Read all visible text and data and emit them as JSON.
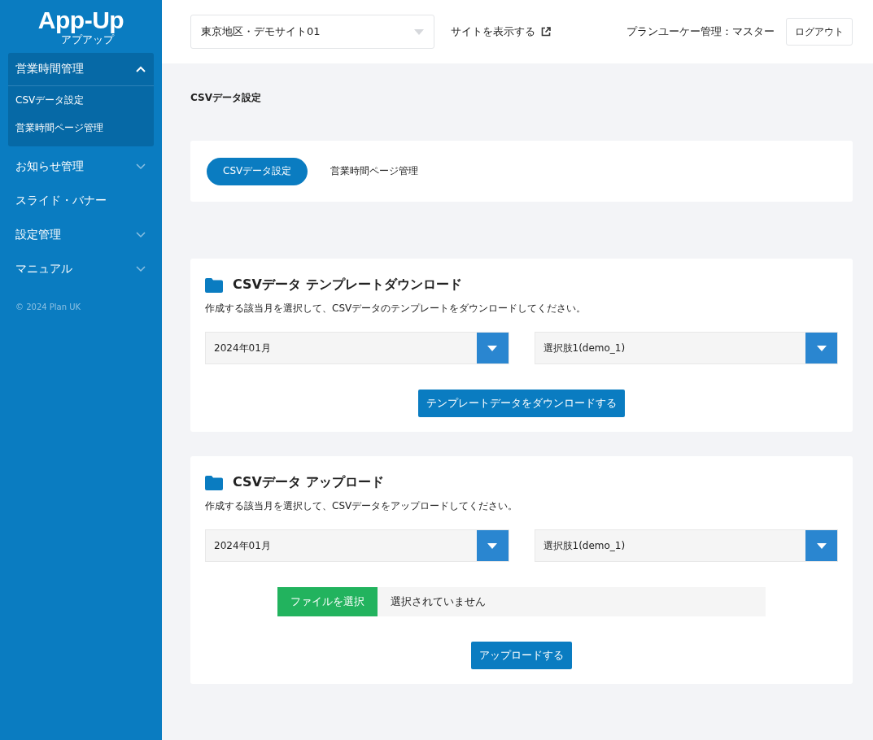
{
  "sidebar": {
    "logo": "App-Up",
    "logo_sub": "アプアップ",
    "items": [
      {
        "label": "営業時間管理",
        "kind": "group",
        "expanded": true,
        "children": [
          {
            "label": "CSVデータ設定"
          },
          {
            "label": "営業時間ページ管理"
          }
        ]
      },
      {
        "label": "お知らせ管理",
        "kind": "group",
        "expanded": false
      },
      {
        "label": "スライド・バナー",
        "kind": "link"
      },
      {
        "label": "設定管理",
        "kind": "group",
        "expanded": false
      },
      {
        "label": "マニュアル",
        "kind": "group",
        "expanded": false
      }
    ],
    "copyright": "© 2024 Plan UK"
  },
  "header": {
    "site_select": "東京地区・デモサイト01",
    "view_site_link": "サイトを表示する",
    "user": "プランユーケー管理：マスター",
    "logout": "ログアウト"
  },
  "page_title": "CSVデータ設定",
  "tabs": [
    {
      "label": "CSVデータ設定",
      "selected": true
    },
    {
      "label": "営業時間ページ管理",
      "selected": false
    }
  ],
  "sections": [
    {
      "title": "CSVデータ テンプレートダウンロード",
      "description": "作成する該当月を選択して、CSVデータのテンプレートをダウンロードしてください。",
      "selects": [
        "2024年01月",
        "選択肢1(demo_1)"
      ],
      "button": "テンプレートデータをダウンロードする"
    },
    {
      "title": "CSVデータ アップロード",
      "description": "作成する該当月を選択して、CSVデータをアップロードしてください。",
      "selects": [
        "2024年01月",
        "選択肢1(demo_1)"
      ],
      "file": {
        "button": "ファイルを選択",
        "status": "選択されていません"
      },
      "button": "アップロードする"
    }
  ]
}
